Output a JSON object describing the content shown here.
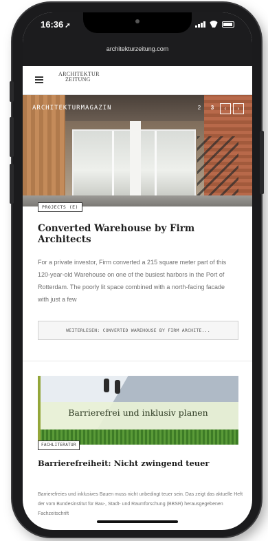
{
  "status_bar": {
    "time": "16:36",
    "time_arrow": "➚"
  },
  "browser": {
    "url": "architekturzeitung.com"
  },
  "site": {
    "logo_line1": "ARCHITEKTUR",
    "logo_line2": "ZEITUNG"
  },
  "hero": {
    "label": "ARCHITEKTURMAGAZIN",
    "pager": [
      "2",
      "3",
      "‹",
      "›"
    ]
  },
  "article1": {
    "category": "PROJECTS (E)",
    "title": "Converted Warehouse by Firm Architects",
    "excerpt": "For a private investor, Firm converted a 215 square meter part of this 120-year-old Warehouse on one of the busiest harbors in the Port of Rotterdam. The poorly lit space combined with a north-facing facade with just a few",
    "read_more": "WEITERLESEN: CONVERTED WAREHOUSE BY FIRM ARCHITE..."
  },
  "article2": {
    "banner_text": "Barrierefrei und inklusiv planen",
    "category": "FACHLITERATUR",
    "title": "Barrierefreiheit: Nicht zwingend teuer",
    "excerpt": "Barrierefreies und inklusives Bauen muss nicht unbedingt teuer sein. Das zeigt das aktuelle Heft der vom Bundesinstitut für Bau-, Stadt- und Raumforschung (BBSR) herausgegebenen Fachzeitschrift"
  },
  "icons": {
    "menu": "hamburger-icon",
    "signal": "signal-icon",
    "wifi": "wifi-icon",
    "battery": "battery-icon"
  }
}
